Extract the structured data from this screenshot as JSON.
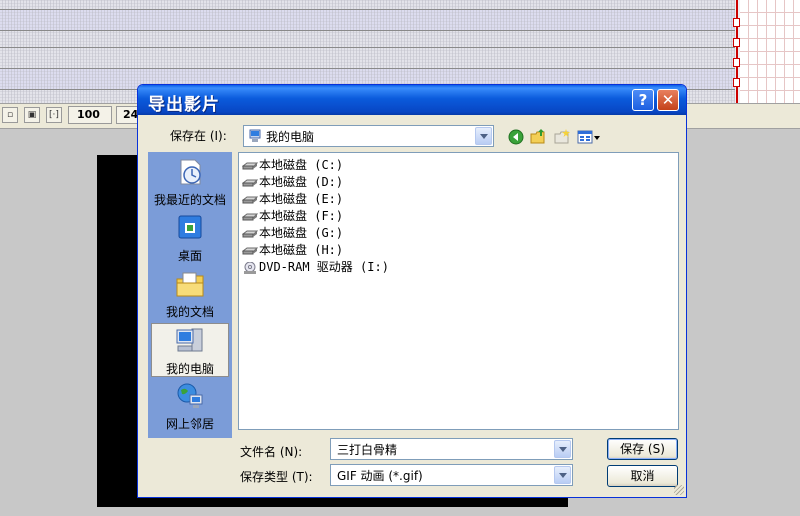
{
  "toolbar": {
    "zoom_value": "100",
    "frame_value": "24"
  },
  "dialog": {
    "title": "导出影片",
    "save_in_label": "保存在 (I):",
    "save_in_value": "我的电脑",
    "places": [
      {
        "label": "我最近的文档",
        "icon": "recent-documents-icon"
      },
      {
        "label": "桌面",
        "icon": "desktop-icon"
      },
      {
        "label": "我的文档",
        "icon": "my-documents-icon"
      },
      {
        "label": "我的电脑",
        "icon": "my-computer-icon"
      },
      {
        "label": "网上邻居",
        "icon": "network-places-icon"
      }
    ],
    "files": [
      "本地磁盘 (C:)",
      "本地磁盘 (D:)",
      "本地磁盘 (E:)",
      "本地磁盘 (F:)",
      "本地磁盘 (G:)",
      "本地磁盘 (H:)",
      "DVD-RAM 驱动器 (I:)"
    ],
    "filename_label": "文件名 (N):",
    "filename_value": "三打白骨精",
    "filetype_label": "保存类型 (T):",
    "filetype_value": "GIF 动画 (*.gif)",
    "save_button": "保存 (S)",
    "cancel_button": "取消",
    "help_glyph": "?",
    "close_glyph": "✕"
  }
}
